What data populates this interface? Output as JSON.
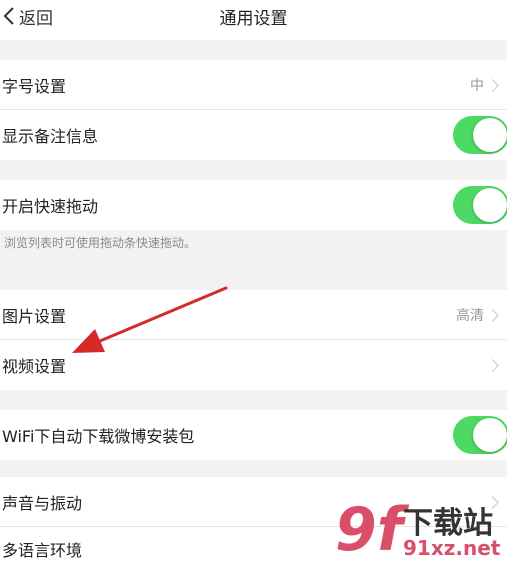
{
  "nav": {
    "back_label": "返回",
    "title": "通用设置"
  },
  "rows": {
    "font_size": {
      "label": "字号设置",
      "value": "中"
    },
    "show_remark": {
      "label": "显示备注信息",
      "toggle_on": true
    },
    "quick_drag": {
      "label": "开启快速拖动",
      "toggle_on": true
    },
    "quick_drag_hint": "浏览列表时可使用拖动条快速拖动。",
    "image": {
      "label": "图片设置",
      "value": "高清"
    },
    "video": {
      "label": "视频设置"
    },
    "wifi_download": {
      "label": "WiFi下自动下载微博安装包",
      "toggle_on": true
    },
    "sound": {
      "label": "声音与振动"
    },
    "language": {
      "label": "多语言环境"
    }
  },
  "watermark": {
    "logo": "9f",
    "text": "下载站",
    "url": "91xz.net"
  },
  "colors": {
    "toggle_on": "#4cd964",
    "annotation_arrow": "#d42a2a",
    "watermark": "#d94f6a"
  }
}
